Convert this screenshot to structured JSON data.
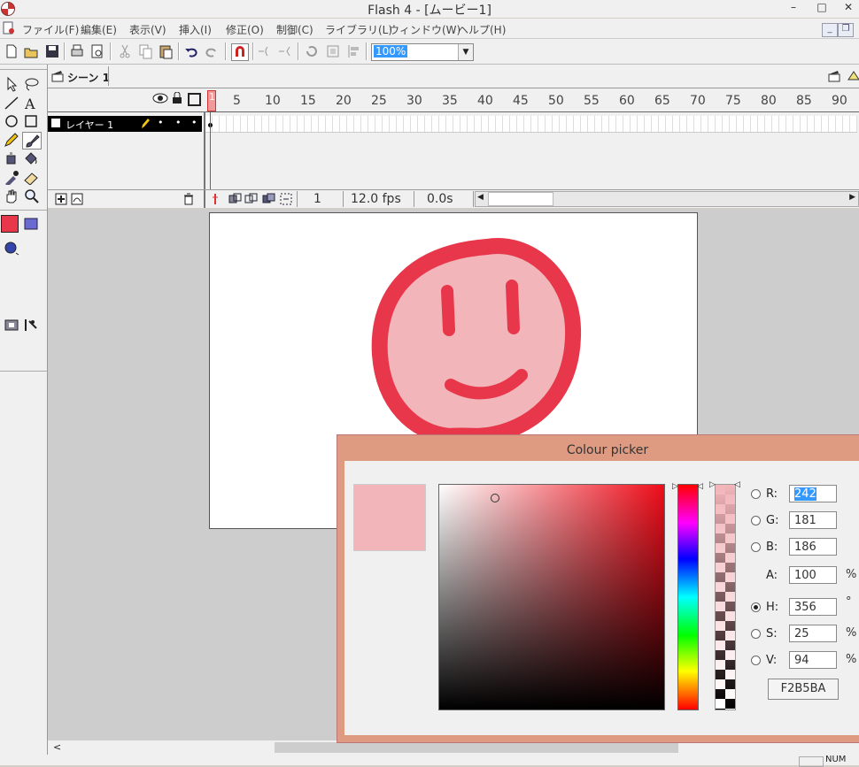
{
  "window": {
    "title": "Flash 4 - [ムービー1]",
    "min": "–",
    "max": "□",
    "close": "✕"
  },
  "menu": [
    "ファイル(F)",
    "編集(E)",
    "表示(V)",
    "挿入(I)",
    "修正(O)",
    "制御(C)",
    "ライブラリ(L)",
    "ウィンドウ(W)",
    "ヘルプ(H)"
  ],
  "toolbar": {
    "zoom": "100%"
  },
  "timeline": {
    "scene": "シーン 1",
    "ruler": [
      "1",
      "5",
      "10",
      "15",
      "20",
      "25",
      "30",
      "35",
      "40",
      "45",
      "50",
      "55",
      "60",
      "65",
      "70",
      "75",
      "80",
      "85",
      "90"
    ],
    "layer": "レイヤー 1",
    "current_frame": "1",
    "fps": "12.0 fps",
    "time": "0.0s"
  },
  "colors": {
    "stroke": "#e8374b",
    "fill": "#f2b5ba",
    "picker_bg": "#de9b82"
  },
  "picker": {
    "title": "Colour picker",
    "r_label": "R:",
    "r": "242",
    "g_label": "G:",
    "g": "181",
    "b_label": "B:",
    "b": "186",
    "a_label": "A:",
    "a": "100",
    "a_unit": "%",
    "h_label": "H:",
    "h": "356",
    "h_unit": "°",
    "s_label": "S:",
    "s": "25",
    "s_unit": "%",
    "v_label": "V:",
    "v": "94",
    "v_unit": "%",
    "hex": "F2B5BA",
    "selected_mode": "H"
  },
  "status": {
    "num": "NUM"
  }
}
